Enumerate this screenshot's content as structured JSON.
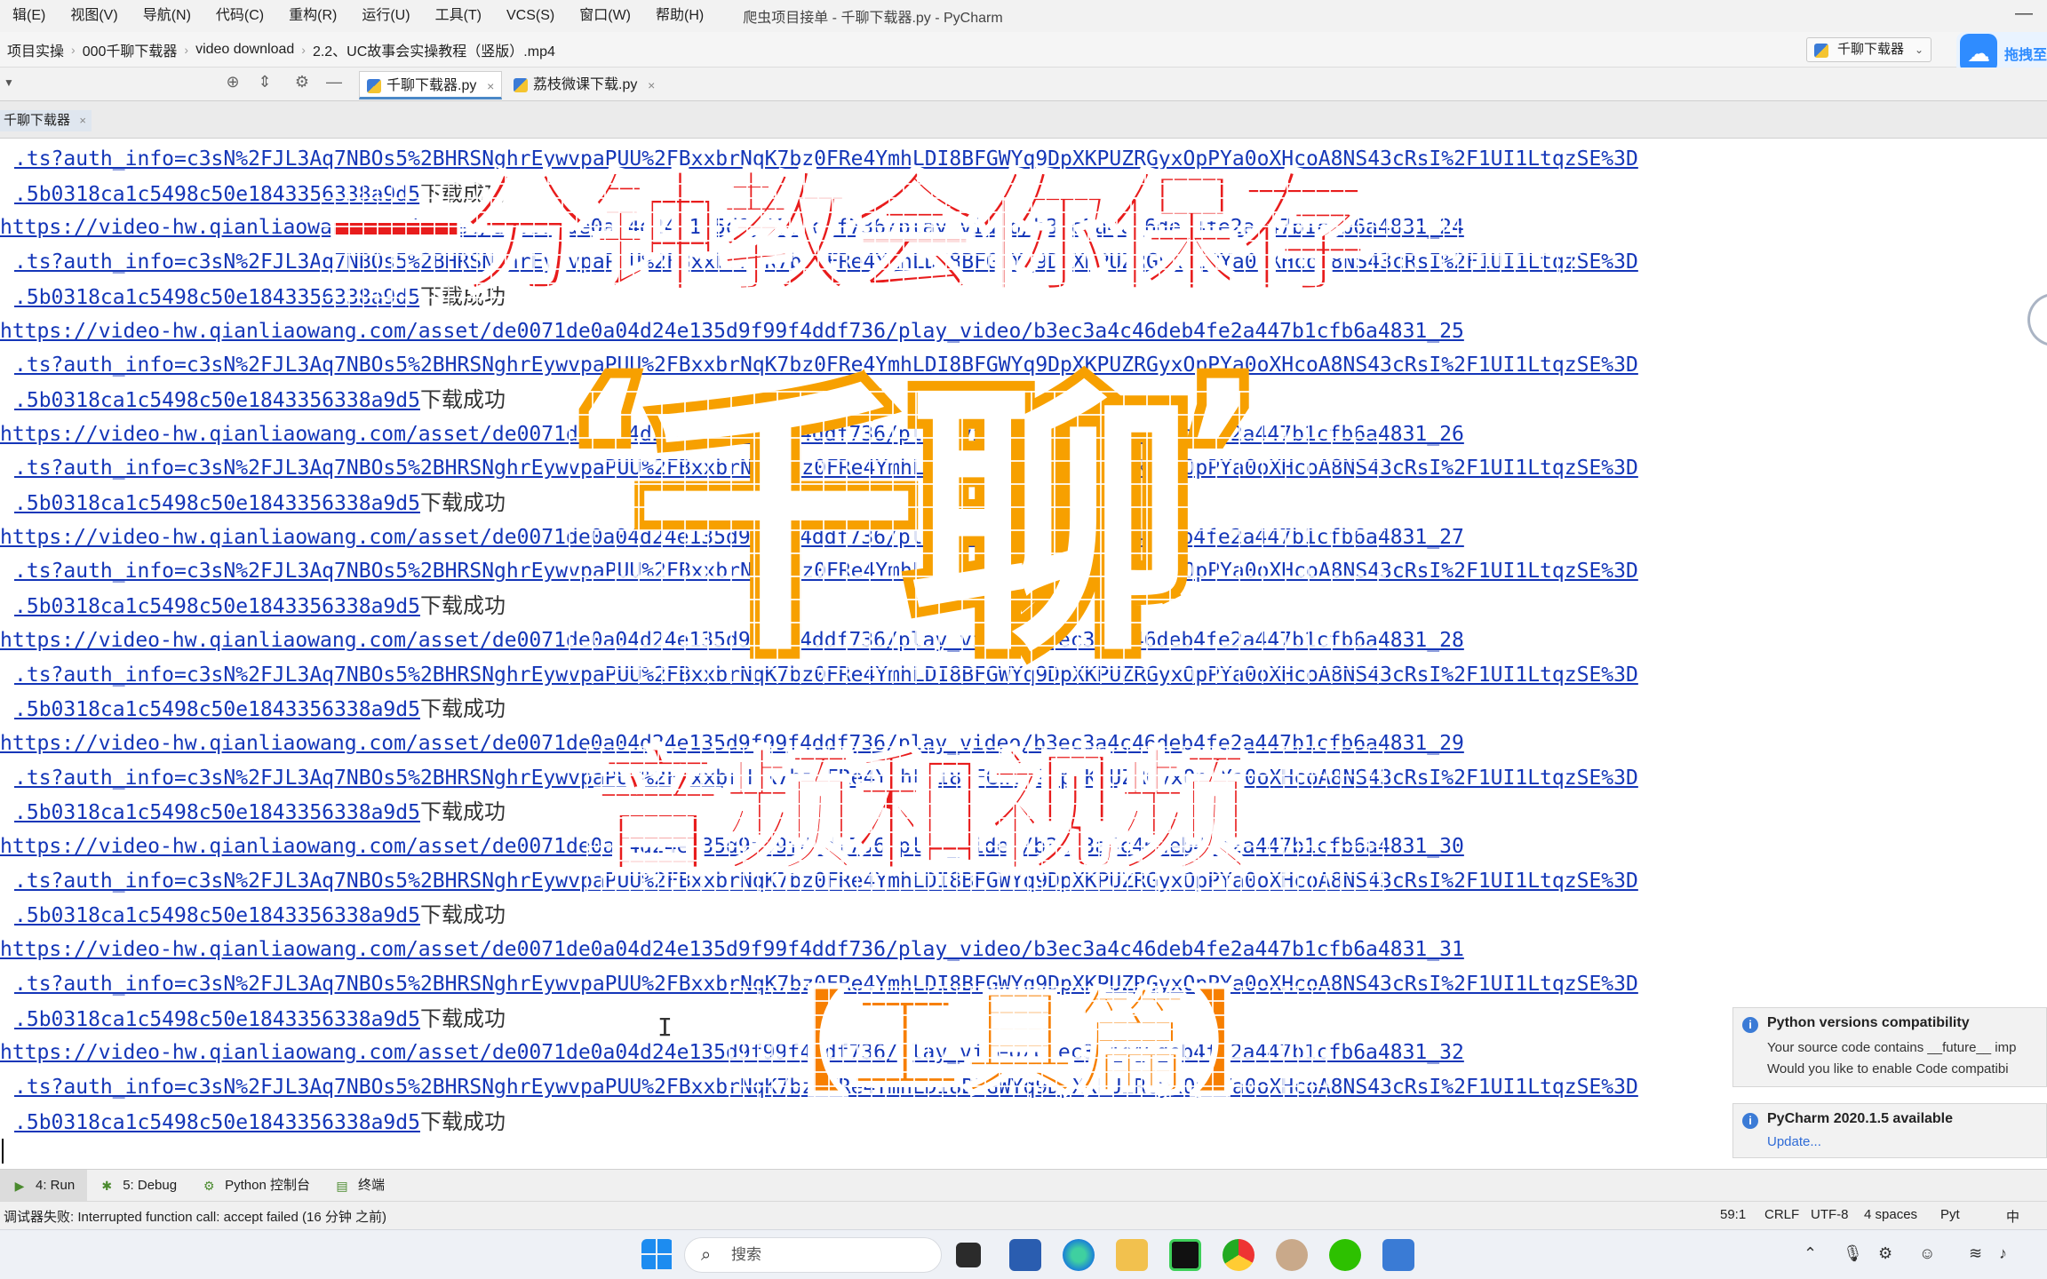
{
  "menubar": {
    "items": [
      "辑(E)",
      "视图(V)",
      "导航(N)",
      "代码(C)",
      "重构(R)",
      "运行(U)",
      "工具(T)",
      "VCS(S)",
      "窗口(W)",
      "帮助(H)"
    ],
    "window_title": "爬虫项目接单 - 千聊下载器.py - PyCharm"
  },
  "navbar": {
    "crumbs": [
      "项目实操",
      "000千聊下载器",
      "video download",
      "2.2、UC故事会实操教程（竖版）.mp4"
    ],
    "run_config": "千聊下载器",
    "baidu_label": "拖拽至"
  },
  "tabs": [
    {
      "label": "千聊下载器.py",
      "active": true
    },
    {
      "label": "荔枝微课下载.py",
      "active": false
    }
  ],
  "run_tab": {
    "label": "千聊下载器"
  },
  "console": {
    "lines": [
      {
        "type": "auth",
        "text": ".ts?auth_info=c3sN%2FJL3Aq7NBOs5%2BHRSNghrEywvpaPUU%2FBxxbrNqK7bz0FRe4YmhLDI8BFGWYq9DpXKPUZRGyxOpPYa0oXHcoA8NS43cRsI%2F1UI1LtqzSE%3D"
      },
      {
        "type": "hash",
        "text": ".5b0318ca1c5498c50e1843356338a9d5",
        "suffix": "下载成功"
      },
      {
        "type": "url",
        "text": "https://video-hw.qianliaowang.com/asset/de0071de0a04d24e135d9f99f4ddf736/play_video/b3ec3a4c46deb4fe2a447b1cfb6a4831_24"
      },
      {
        "type": "auth",
        "text": ".ts?auth_info=c3sN%2FJL3Aq7NBOs5%2BHRSNghrEywvpaPUU%2FBxxbrNqK7bz0FRe4YmhLDI8BFGWYq9DpXKPUZRGyxOpPYa0oXHcoA8NS43cRsI%2F1UI1LtqzSE%3D"
      },
      {
        "type": "hash",
        "text": ".5b0318ca1c5498c50e1843356338a9d5",
        "suffix": "下载成功"
      },
      {
        "type": "url",
        "text": "https://video-hw.qianliaowang.com/asset/de0071de0a04d24e135d9f99f4ddf736/play_video/b3ec3a4c46deb4fe2a447b1cfb6a4831_25"
      },
      {
        "type": "auth",
        "text": ".ts?auth_info=c3sN%2FJL3Aq7NBOs5%2BHRSNghrEywvpaPUU%2FBxxbrNqK7bz0FRe4YmhLDI8BFGWYq9DpXKPUZRGyxOpPYa0oXHcoA8NS43cRsI%2F1UI1LtqzSE%3D"
      },
      {
        "type": "hash",
        "text": ".5b0318ca1c5498c50e1843356338a9d5",
        "suffix": "下载成功"
      },
      {
        "type": "url",
        "text": "https://video-hw.qianliaowang.com/asset/de0071de0a04d24e135d9f99f4ddf736/play_video/b3ec3a4c46deb4fe2a447b1cfb6a4831_26"
      },
      {
        "type": "auth",
        "text": ".ts?auth_info=c3sN%2FJL3Aq7NBOs5%2BHRSNghrEywvpaPUU%2FBxxbrNqK7bz0FRe4YmhLDI8BFGWYq9DpXKPUZRGyxOpPYa0oXHcoA8NS43cRsI%2F1UI1LtqzSE%3D"
      },
      {
        "type": "hash",
        "text": ".5b0318ca1c5498c50e1843356338a9d5",
        "suffix": "下载成功"
      },
      {
        "type": "url",
        "text": "https://video-hw.qianliaowang.com/asset/de0071de0a04d24e135d9f99f4ddf736/play_video/b3ec3a4c46deb4fe2a447b1cfb6a4831_27"
      },
      {
        "type": "auth",
        "text": ".ts?auth_info=c3sN%2FJL3Aq7NBOs5%2BHRSNghrEywvpaPUU%2FBxxbrNqK7bz0FRe4YmhLDI8BFGWYq9DpXKPUZRGyxOpPYa0oXHcoA8NS43cRsI%2F1UI1LtqzSE%3D"
      },
      {
        "type": "hash",
        "text": ".5b0318ca1c5498c50e1843356338a9d5",
        "suffix": "下载成功"
      },
      {
        "type": "url",
        "text": "https://video-hw.qianliaowang.com/asset/de0071de0a04d24e135d9f99f4ddf736/play_video/b3ec3a4c46deb4fe2a447b1cfb6a4831_28"
      },
      {
        "type": "auth",
        "text": ".ts?auth_info=c3sN%2FJL3Aq7NBOs5%2BHRSNghrEywvpaPUU%2FBxxbrNqK7bz0FRe4YmhLDI8BFGWYq9DpXKPUZRGyxOpPYa0oXHcoA8NS43cRsI%2F1UI1LtqzSE%3D"
      },
      {
        "type": "hash",
        "text": ".5b0318ca1c5498c50e1843356338a9d5",
        "suffix": "下载成功"
      },
      {
        "type": "url",
        "text": "https://video-hw.qianliaowang.com/asset/de0071de0a04d24e135d9f99f4ddf736/play_video/b3ec3a4c46deb4fe2a447b1cfb6a4831_29"
      },
      {
        "type": "auth",
        "text": ".ts?auth_info=c3sN%2FJL3Aq7NBOs5%2BHRSNghrEywvpaPUU%2FBxxbrNqK7bz0FRe4YmhLDI8BFGWYq9DpXKPUZRGyxOpPYa0oXHcoA8NS43cRsI%2F1UI1LtqzSE%3D"
      },
      {
        "type": "hash",
        "text": ".5b0318ca1c5498c50e1843356338a9d5",
        "suffix": "下载成功"
      },
      {
        "type": "url",
        "text": "https://video-hw.qianliaowang.com/asset/de0071de0a04d24e135d9f99f4ddf736/play_video/b3ec3a4c46deb4fe2a447b1cfb6a4831_30"
      },
      {
        "type": "auth",
        "text": ".ts?auth_info=c3sN%2FJL3Aq7NBOs5%2BHRSNghrEywvpaPUU%2FBxxbrNqK7bz0FRe4YmhLDI8BFGWYq9DpXKPUZRGyxOpPYa0oXHcoA8NS43cRsI%2F1UI1LtqzSE%3D"
      },
      {
        "type": "hash",
        "text": ".5b0318ca1c5498c50e1843356338a9d5",
        "suffix": "下载成功"
      },
      {
        "type": "url",
        "text": "https://video-hw.qianliaowang.com/asset/de0071de0a04d24e135d9f99f4ddf736/play_video/b3ec3a4c46deb4fe2a447b1cfb6a4831_31"
      },
      {
        "type": "auth",
        "text": ".ts?auth_info=c3sN%2FJL3Aq7NBOs5%2BHRSNghrEywvpaPUU%2FBxxbrNqK7bz0FRe4YmhLDI8BFGWYq9DpXKPUZRGyxOpPYa0oXHcoA8NS43cRsI%2F1UI1LtqzSE%3D"
      },
      {
        "type": "hash",
        "text": ".5b0318ca1c5498c50e1843356338a9d5",
        "suffix": "下载成功"
      },
      {
        "type": "url",
        "text": "https://video-hw.qianliaowang.com/asset/de0071de0a04d24e135d9f99f4ddf736/play_video/b3ec3a4c46deb4fe2a447b1cfb6a4831_32"
      },
      {
        "type": "auth",
        "text": ".ts?auth_info=c3sN%2FJL3Aq7NBOs5%2BHRSNghrEywvpaPUU%2FBxxbrNqK7bz0FRe4YmhLDI8BFGWYq9DpXKPUZRGyxOpPYa0oXHcoA8NS43cRsI%2F1UI1LtqzSE%3D"
      },
      {
        "type": "hash",
        "text": ".5b0318ca1c5498c50e1843356338a9d5",
        "suffix": "下载成功"
      }
    ]
  },
  "overlay": {
    "line1": "一分钟教会你保存",
    "line2_open": "‘",
    "line2_main": "千聊",
    "line2_close": "’",
    "line3": "音频和视频",
    "line4": "【工具篇】",
    "colors": {
      "red": "#e81c1c",
      "orange": "#f7a000",
      "deep_orange": "#f77f00"
    }
  },
  "notifications": [
    {
      "title": "Python versions compatibility",
      "body1": "Your source code contains __future__ imp",
      "body2": "Would you like to enable Code compatibi"
    },
    {
      "title": "PyCharm 2020.1.5 available",
      "link": "Update..."
    }
  ],
  "bottom_tools": [
    {
      "label": "4: Run",
      "icon": "▶",
      "active": true
    },
    {
      "label": "5: Debug",
      "icon": "✱",
      "active": false
    },
    {
      "label": "Python 控制台",
      "icon": "⚙",
      "active": false
    },
    {
      "label": "终端",
      "icon": "▤",
      "active": false
    }
  ],
  "status": {
    "message": "调试器失败: Interrupted function call: accept failed (16 分钟 之前)",
    "position": "59:1",
    "line_sep": "CRLF",
    "encoding": "UTF-8",
    "indent": "4 spaces",
    "interpreter": "Pyt",
    "ime": "中"
  },
  "taskbar": {
    "search_placeholder": "搜索"
  }
}
